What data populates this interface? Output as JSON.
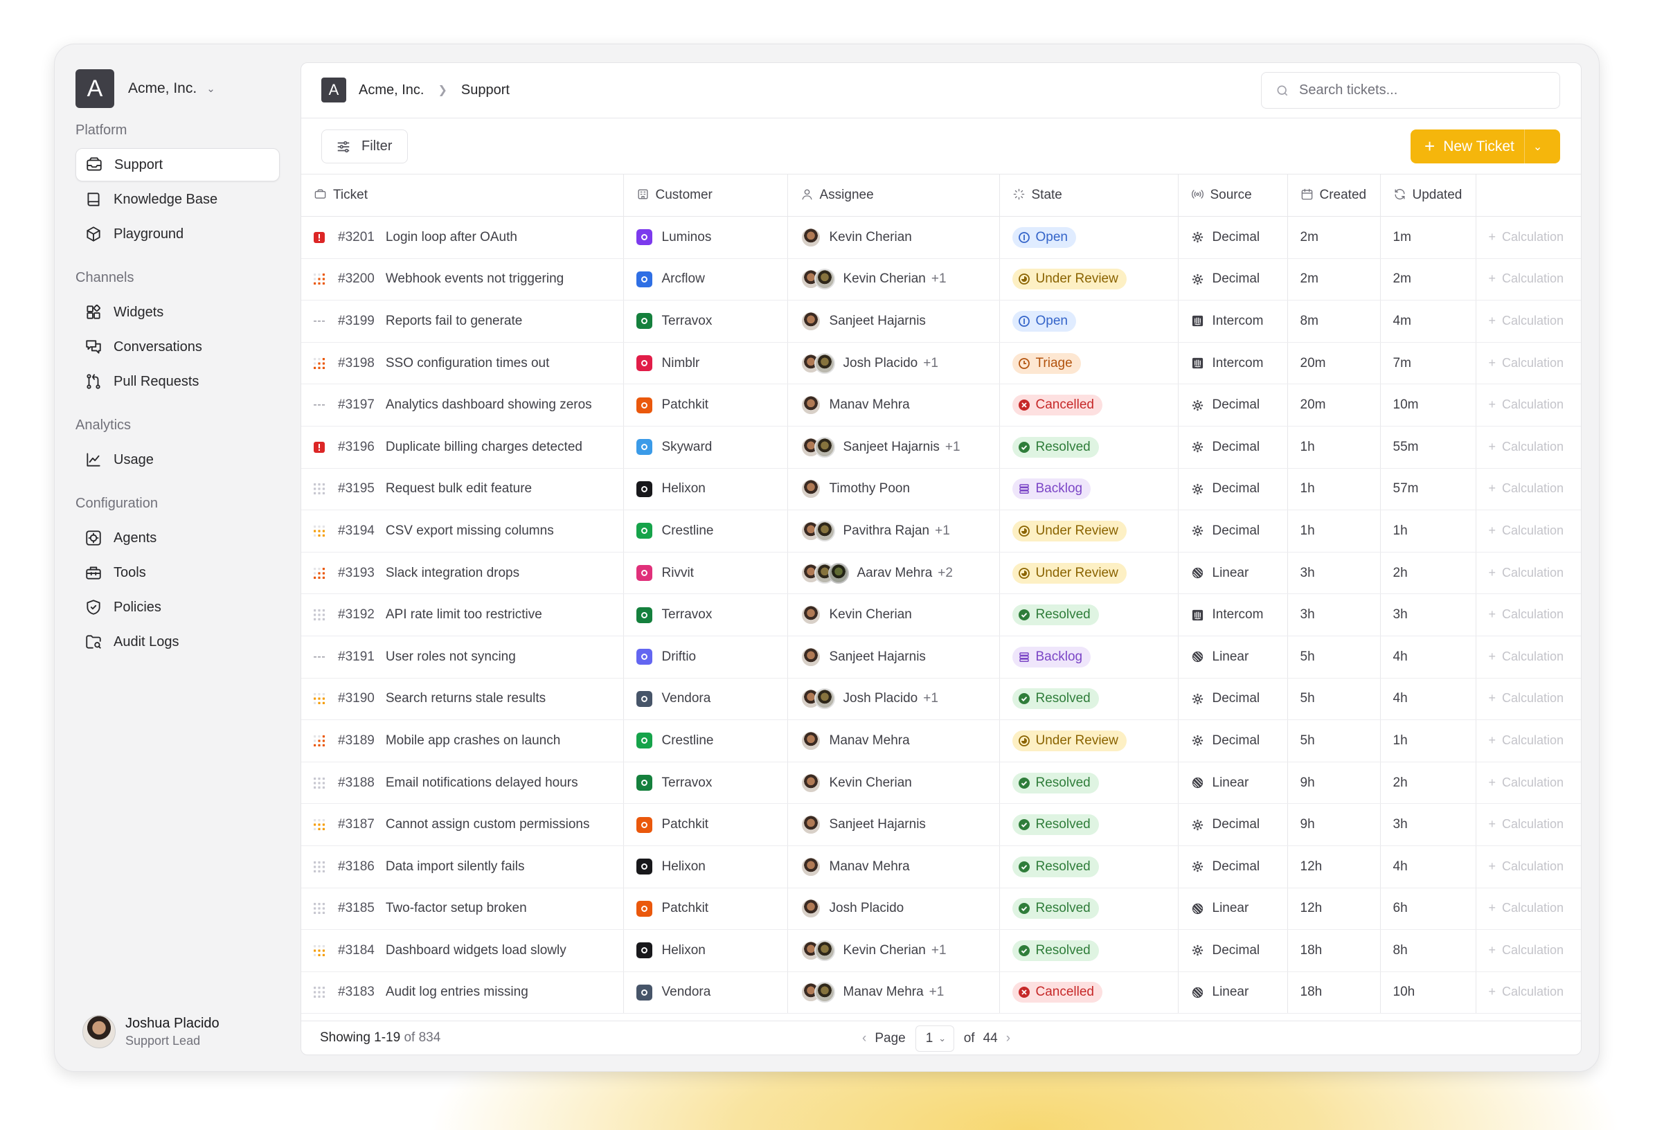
{
  "org": {
    "logo_letter": "A",
    "name": "Acme, Inc."
  },
  "sidebar": {
    "sections": [
      {
        "title": "Platform",
        "items": [
          {
            "label": "Support",
            "icon": "inbox-icon",
            "active": true
          },
          {
            "label": "Knowledge Base",
            "icon": "book-icon"
          },
          {
            "label": "Playground",
            "icon": "cube-icon"
          }
        ]
      },
      {
        "title": "Channels",
        "items": [
          {
            "label": "Widgets",
            "icon": "widgets-icon"
          },
          {
            "label": "Conversations",
            "icon": "chat-icon"
          },
          {
            "label": "Pull Requests",
            "icon": "git-pull-request-icon"
          }
        ]
      },
      {
        "title": "Analytics",
        "items": [
          {
            "label": "Usage",
            "icon": "line-chart-icon"
          }
        ]
      },
      {
        "title": "Configuration",
        "items": [
          {
            "label": "Agents",
            "icon": "bot-icon"
          },
          {
            "label": "Tools",
            "icon": "toolbox-icon"
          },
          {
            "label": "Policies",
            "icon": "shield-icon"
          },
          {
            "label": "Audit Logs",
            "icon": "folder-search-icon"
          }
        ]
      }
    ]
  },
  "user": {
    "name": "Joshua Placido",
    "role": "Support Lead"
  },
  "breadcrumb": {
    "logo_letter": "A",
    "org": "Acme, Inc.",
    "page": "Support"
  },
  "search": {
    "placeholder": "Search tickets...",
    "value": ""
  },
  "toolbar": {
    "filter_label": "Filter",
    "new_ticket_label": "New Ticket"
  },
  "columns": [
    "Ticket",
    "Customer",
    "Assignee",
    "State",
    "Source",
    "Created",
    "Updated",
    ""
  ],
  "calc_label": "Calculation",
  "colors": {
    "accent": "#f5b60c"
  },
  "customers": {
    "Luminos": "#7c3aed",
    "Arcflow": "#2f6fe4",
    "Terravox": "#15803d",
    "Nimblr": "#e11d48",
    "Patchkit": "#ea580c",
    "Skyward": "#3b9be8",
    "Helixon": "#18181b",
    "Crestline": "#16a34a",
    "Rivvit": "#e0307a",
    "Driftio": "#6366f1",
    "Vendora": "#475569"
  },
  "rows": [
    {
      "id": "#3201",
      "title": "Login loop after OAuth",
      "priority": "urgent",
      "customer": "Luminos",
      "assignee": "Kevin Cherian",
      "extra": "",
      "avatars": 1,
      "state": "Open",
      "source": "Decimal",
      "created": "2m",
      "updated": "1m"
    },
    {
      "id": "#3200",
      "title": "Webhook events not triggering",
      "priority": "high",
      "customer": "Arcflow",
      "assignee": "Kevin Cherian",
      "extra": "+1",
      "avatars": 2,
      "state": "Under Review",
      "source": "Decimal",
      "created": "2m",
      "updated": "2m"
    },
    {
      "id": "#3199",
      "title": "Reports fail to generate",
      "priority": "none",
      "customer": "Terravox",
      "assignee": "Sanjeet Hajarnis",
      "extra": "",
      "avatars": 1,
      "state": "Open",
      "source": "Intercom",
      "created": "8m",
      "updated": "4m"
    },
    {
      "id": "#3198",
      "title": "SSO configuration times out",
      "priority": "high",
      "customer": "Nimblr",
      "assignee": "Josh Placido",
      "extra": "+1",
      "avatars": 2,
      "state": "Triage",
      "source": "Intercom",
      "created": "20m",
      "updated": "7m"
    },
    {
      "id": "#3197",
      "title": "Analytics dashboard showing zeros",
      "priority": "none",
      "customer": "Patchkit",
      "assignee": "Manav Mehra",
      "extra": "",
      "avatars": 1,
      "state": "Cancelled",
      "source": "Decimal",
      "created": "20m",
      "updated": "10m"
    },
    {
      "id": "#3196",
      "title": "Duplicate billing charges detected",
      "priority": "urgent",
      "customer": "Skyward",
      "assignee": "Sanjeet Hajarnis",
      "extra": "+1",
      "avatars": 2,
      "state": "Resolved",
      "source": "Decimal",
      "created": "1h",
      "updated": "55m"
    },
    {
      "id": "#3195",
      "title": "Request bulk edit feature",
      "priority": "low",
      "customer": "Helixon",
      "assignee": "Timothy Poon",
      "extra": "",
      "avatars": 1,
      "state": "Backlog",
      "source": "Decimal",
      "created": "1h",
      "updated": "57m"
    },
    {
      "id": "#3194",
      "title": "CSV export missing columns",
      "priority": "medium",
      "customer": "Crestline",
      "assignee": "Pavithra Rajan",
      "extra": "+1",
      "avatars": 2,
      "state": "Under Review",
      "source": "Decimal",
      "created": "1h",
      "updated": "1h"
    },
    {
      "id": "#3193",
      "title": "Slack integration drops",
      "priority": "high",
      "customer": "Rivvit",
      "assignee": "Aarav Mehra",
      "extra": "+2",
      "avatars": 3,
      "state": "Under Review",
      "source": "Linear",
      "created": "3h",
      "updated": "2h"
    },
    {
      "id": "#3192",
      "title": "API rate limit too restrictive",
      "priority": "low",
      "customer": "Terravox",
      "assignee": "Kevin Cherian",
      "extra": "",
      "avatars": 1,
      "state": "Resolved",
      "source": "Intercom",
      "created": "3h",
      "updated": "3h"
    },
    {
      "id": "#3191",
      "title": "User roles not syncing",
      "priority": "none",
      "customer": "Driftio",
      "assignee": "Sanjeet Hajarnis",
      "extra": "",
      "avatars": 1,
      "state": "Backlog",
      "source": "Linear",
      "created": "5h",
      "updated": "4h"
    },
    {
      "id": "#3190",
      "title": "Search returns stale results",
      "priority": "medium",
      "customer": "Vendora",
      "assignee": "Josh Placido",
      "extra": "+1",
      "avatars": 2,
      "state": "Resolved",
      "source": "Decimal",
      "created": "5h",
      "updated": "4h"
    },
    {
      "id": "#3189",
      "title": "Mobile app crashes on launch",
      "priority": "high",
      "customer": "Crestline",
      "assignee": "Manav Mehra",
      "extra": "",
      "avatars": 1,
      "state": "Under Review",
      "source": "Decimal",
      "created": "5h",
      "updated": "1h"
    },
    {
      "id": "#3188",
      "title": "Email notifications delayed hours",
      "priority": "low",
      "customer": "Terravox",
      "assignee": "Kevin Cherian",
      "extra": "",
      "avatars": 1,
      "state": "Resolved",
      "source": "Linear",
      "created": "9h",
      "updated": "2h"
    },
    {
      "id": "#3187",
      "title": "Cannot assign custom permissions",
      "priority": "medium",
      "customer": "Patchkit",
      "assignee": "Sanjeet Hajarnis",
      "extra": "",
      "avatars": 1,
      "state": "Resolved",
      "source": "Decimal",
      "created": "9h",
      "updated": "3h"
    },
    {
      "id": "#3186",
      "title": "Data import silently fails",
      "priority": "low",
      "customer": "Helixon",
      "assignee": "Manav Mehra",
      "extra": "",
      "avatars": 1,
      "state": "Resolved",
      "source": "Decimal",
      "created": "12h",
      "updated": "4h"
    },
    {
      "id": "#3185",
      "title": "Two-factor setup broken",
      "priority": "low",
      "customer": "Patchkit",
      "assignee": "Josh Placido",
      "extra": "",
      "avatars": 1,
      "state": "Resolved",
      "source": "Linear",
      "created": "12h",
      "updated": "6h"
    },
    {
      "id": "#3184",
      "title": "Dashboard widgets load slowly",
      "priority": "medium",
      "customer": "Helixon",
      "assignee": "Kevin Cherian",
      "extra": "+1",
      "avatars": 2,
      "state": "Resolved",
      "source": "Decimal",
      "created": "18h",
      "updated": "8h"
    },
    {
      "id": "#3183",
      "title": "Audit log entries missing",
      "priority": "low",
      "customer": "Vendora",
      "assignee": "Manav Mehra",
      "extra": "+1",
      "avatars": 2,
      "state": "Cancelled",
      "source": "Linear",
      "created": "18h",
      "updated": "10h"
    }
  ],
  "footer": {
    "showing": "Showing 1-19",
    "of_total": "of 834",
    "page_label": "Page",
    "page_value": "1",
    "of_label": "of",
    "total_pages": "44"
  }
}
